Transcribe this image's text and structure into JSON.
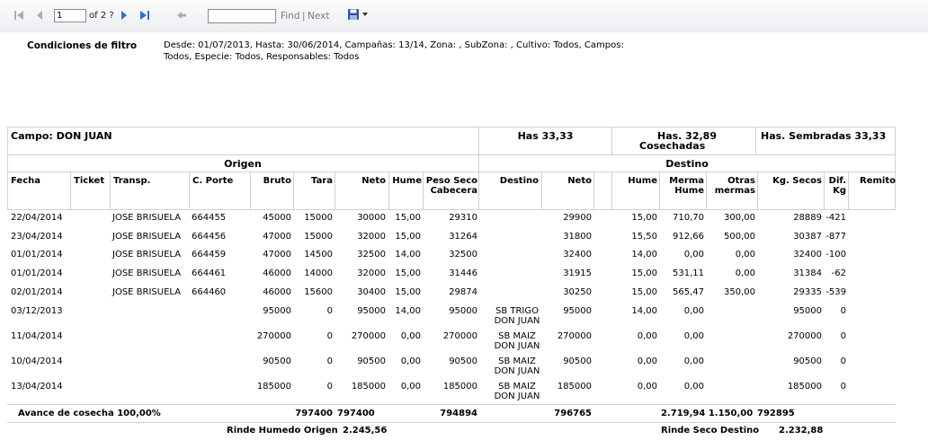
{
  "toolbar": {
    "page_value": "1",
    "page_of": "of 2 ?",
    "find_label": "Find",
    "next_label": "Next",
    "find_value": ""
  },
  "filter": {
    "label": "Condiciones de filtro",
    "line1": "Desde: 01/07/2013, Hasta: 30/06/2014, Campañas: 13/14, Zona: , SubZona: , Cultivo: Todos, Campos:",
    "line2": "Todos, Especie: Todos, Responsables: Todos"
  },
  "campo": {
    "name": "Campo: DON JUAN",
    "has": "Has 33,33",
    "has_cosechadas_1": "Has. 32,89",
    "has_cosechadas_2": "Cosechadas",
    "has_sembradas": "Has. Sembradas 33,33"
  },
  "groups": {
    "origen": "Origen",
    "destino": "Destino"
  },
  "columns": {
    "fecha": "Fecha",
    "ticket": "Ticket",
    "transp": "Transp.",
    "cporte": "C. Porte",
    "bruto": "Bruto",
    "tara": "Tara",
    "neto": "Neto",
    "hume": "Hume",
    "peso_seco_1": "Peso Seco",
    "peso_seco_2": "Cabecera",
    "destino": "Destino",
    "dneto": "Neto",
    "dhume": "Hume",
    "merma_1": "Merma",
    "merma_2": "Hume",
    "otras_1": "Otras",
    "otras_2": "mermas",
    "kgsecos": "Kg. Secos",
    "dif_1": "Dif.",
    "dif_2": "Kg",
    "remito": "Remito"
  },
  "rows": [
    {
      "fecha": "22/04/2014",
      "transp": "JOSE BRISUELA",
      "cporte": "664455",
      "bruto": "45000",
      "tara": "15000",
      "neto": "30000",
      "hume": "15,00",
      "pseco": "29310",
      "dest1": "",
      "dest2": "",
      "dneto": "29900",
      "dhume": "15,00",
      "merma": "710,70",
      "otras": "300,00",
      "kgsecos": "28889",
      "dif": "-421"
    },
    {
      "fecha": "23/04/2014",
      "transp": "JOSE BRISUELA",
      "cporte": "664456",
      "bruto": "47000",
      "tara": "15000",
      "neto": "32000",
      "hume": "15,00",
      "pseco": "31264",
      "dest1": "",
      "dest2": "",
      "dneto": "31800",
      "dhume": "15,50",
      "merma": "912,66",
      "otras": "500,00",
      "kgsecos": "30387",
      "dif": "-877"
    },
    {
      "fecha": "01/01/2014",
      "transp": "JOSE BRISUELA",
      "cporte": "664459",
      "bruto": "47000",
      "tara": "14500",
      "neto": "32500",
      "hume": "14,00",
      "pseco": "32500",
      "dest1": "",
      "dest2": "",
      "dneto": "32400",
      "dhume": "14,00",
      "merma": "0,00",
      "otras": "0,00",
      "kgsecos": "32400",
      "dif": "-100"
    },
    {
      "fecha": "01/01/2014",
      "transp": "JOSE BRISUELA",
      "cporte": "664461",
      "bruto": "46000",
      "tara": "14000",
      "neto": "32000",
      "hume": "15,00",
      "pseco": "31446",
      "dest1": "",
      "dest2": "",
      "dneto": "31915",
      "dhume": "15,00",
      "merma": "531,11",
      "otras": "0,00",
      "kgsecos": "31384",
      "dif": "-62"
    },
    {
      "fecha": "02/01/2014",
      "transp": "JOSE BRISUELA",
      "cporte": "664460",
      "bruto": "46000",
      "tara": "15600",
      "neto": "30400",
      "hume": "15,00",
      "pseco": "29874",
      "dest1": "",
      "dest2": "",
      "dneto": "30250",
      "dhume": "15,00",
      "merma": "565,47",
      "otras": "350,00",
      "kgsecos": "29335",
      "dif": "-539"
    },
    {
      "fecha": "03/12/2013",
      "transp": "",
      "cporte": "",
      "bruto": "95000",
      "tara": "0",
      "neto": "95000",
      "hume": "14,00",
      "pseco": "95000",
      "dest1": "SB TRIGO",
      "dest2": "DON JUAN",
      "dneto": "95000",
      "dhume": "14,00",
      "merma": "0,00",
      "otras": "",
      "kgsecos": "95000",
      "dif": "0"
    },
    {
      "fecha": "11/04/2014",
      "transp": "",
      "cporte": "",
      "bruto": "270000",
      "tara": "0",
      "neto": "270000",
      "hume": "0,00",
      "pseco": "270000",
      "dest1": "SB MAIZ",
      "dest2": "DON JUAN",
      "dneto": "270000",
      "dhume": "0,00",
      "merma": "0,00",
      "otras": "",
      "kgsecos": "270000",
      "dif": "0"
    },
    {
      "fecha": "10/04/2014",
      "transp": "",
      "cporte": "",
      "bruto": "90500",
      "tara": "0",
      "neto": "90500",
      "hume": "0,00",
      "pseco": "90500",
      "dest1": "SB MAIZ",
      "dest2": "DON JUAN",
      "dneto": "90500",
      "dhume": "0,00",
      "merma": "0,00",
      "otras": "",
      "kgsecos": "90500",
      "dif": "0"
    },
    {
      "fecha": "13/04/2014",
      "transp": "",
      "cporte": "",
      "bruto": "185000",
      "tara": "0",
      "neto": "185000",
      "hume": "0,00",
      "pseco": "185000",
      "dest1": "SB MAIZ",
      "dest2": "DON JUAN",
      "dneto": "185000",
      "dhume": "0,00",
      "merma": "0,00",
      "otras": "",
      "kgsecos": "185000",
      "dif": "0"
    }
  ],
  "totals": {
    "avance": "Avance de cosecha 100,00%",
    "tara": "797400",
    "neto": "797400",
    "pseco": "794894",
    "dneto": "796765",
    "merma_otras": "2.719,94 1.150,00",
    "kgsecos": "792895"
  },
  "rinde": {
    "humedo_label": "Rinde Humedo Origen",
    "humedo_value": "2.245,56",
    "seco_label": "Rinde Seco Destino",
    "seco_value": "2.232,88"
  }
}
